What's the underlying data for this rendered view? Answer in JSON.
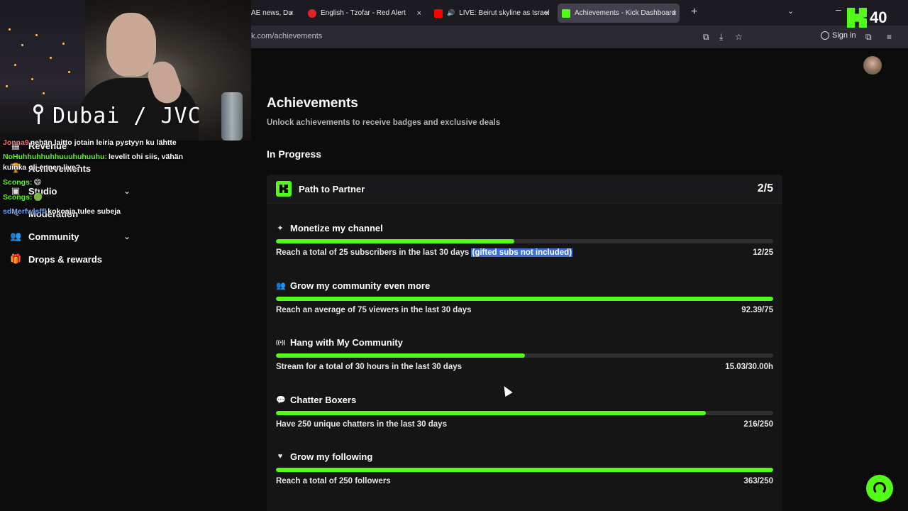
{
  "browser": {
    "tabs": [
      {
        "label": "AE news, Du",
        "favicon_color": "#2b2a33"
      },
      {
        "label": "English - Tzofar - Red Alert",
        "favicon_color": "#e0242b"
      },
      {
        "label": "LIVE: Beirut skyline as Israel",
        "favicon_color": "#ff0000"
      },
      {
        "label": "Achievements - Kick Dashboard",
        "favicon_color": "#53fc18"
      }
    ],
    "url": "k.com/achievements",
    "sign_in": "Sign in",
    "close_glyph": "×",
    "new_tab_glyph": "+"
  },
  "stream_overlay": {
    "location": "Dubai / JVC",
    "counter": "40"
  },
  "sidebar": {
    "items": [
      {
        "label": "Revenue"
      },
      {
        "label": "Achievements"
      },
      {
        "label": "Studio"
      },
      {
        "label": "Moderation"
      },
      {
        "label": "Community"
      },
      {
        "label": "Drops & rewards"
      }
    ]
  },
  "chat": {
    "lines": [
      {
        "user": "Jonna9",
        "user_color": "#ff6b6b",
        "text": "nehän laitto jotain leiria pystyyn ku lähtte"
      },
      {
        "user": "NoHuhhuhhuhhuuuhuhuuhu:",
        "user_color": "#53fc18",
        "text": "levelit ohi siis, vähän"
      },
      {
        "user": "",
        "user_color": "#ffffff",
        "text": "kuinka oli ennen live?"
      },
      {
        "user": "Scongs:",
        "user_color": "#53fc18",
        "text": "😄"
      },
      {
        "user": "Scongs:",
        "user_color": "#53fc18",
        "text": "🟢"
      },
      {
        "user": "sdMerfwlsffl",
        "user_color": "#7aa2ff",
        "text": "kokoaja tulee subeja"
      }
    ]
  },
  "main": {
    "title": "Achievements",
    "subtitle": "Unlock achievements to receive badges and exclusive deals",
    "section": "In Progress",
    "card": {
      "title": "Path to Partner",
      "count": "2/5",
      "achievements": [
        {
          "icon": "sparkle-icon",
          "glyph": "✦",
          "title": "Monetize my channel",
          "desc": "Reach a total of 25 subscribers in the last 30 days",
          "highlight": "(gifted subs not included)",
          "value": "12/25",
          "progress": 0.48
        },
        {
          "icon": "community-icon",
          "glyph": "👥",
          "title": "Grow my community even more",
          "desc": "Reach an average of 75 viewers in the last 30 days",
          "highlight": "",
          "value": "92.39/75",
          "progress": 1.0
        },
        {
          "icon": "broadcast-icon",
          "glyph": "((•))",
          "title": "Hang with My Community",
          "desc": "Stream for a total of 30 hours in the last 30 days",
          "highlight": "",
          "value": "15.03/30.00h",
          "progress": 0.5
        },
        {
          "icon": "chat-bubble-icon",
          "glyph": "💬",
          "title": "Chatter Boxers",
          "desc": "Have 250 unique chatters in the last 30 days",
          "highlight": "",
          "value": "216/250",
          "progress": 0.864
        },
        {
          "icon": "heart-icon",
          "glyph": "♥",
          "title": "Grow my following",
          "desc": "Reach a total of 250 followers",
          "highlight": "",
          "value": "363/250",
          "progress": 1.0
        }
      ]
    }
  },
  "colors": {
    "accent": "#53fc18",
    "background": "#0c0c0d",
    "card": "#151516",
    "track": "#2f2f33",
    "selection": "#3d6fd9"
  }
}
